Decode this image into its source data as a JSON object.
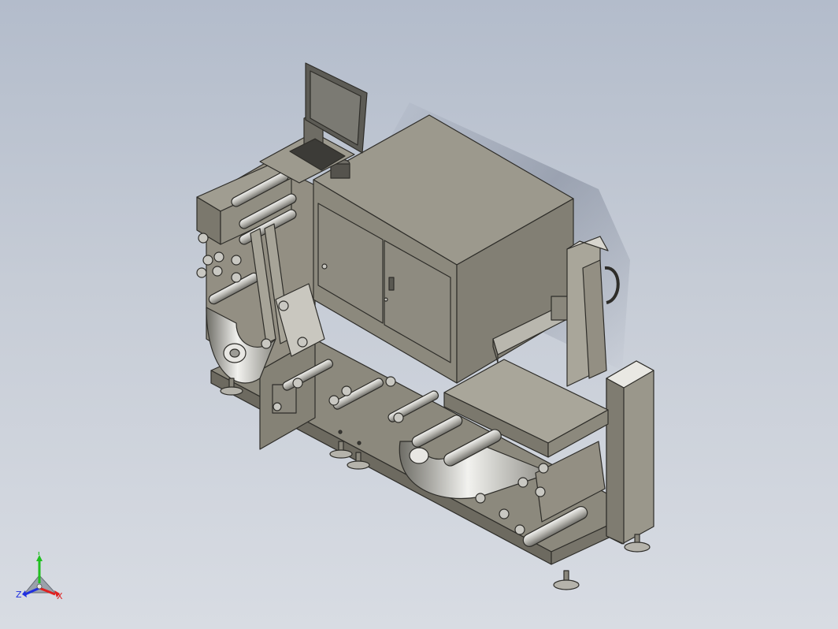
{
  "viewport": {
    "background_top": "#b3bccb",
    "background_bottom": "#d8dce3",
    "model_color": "#8f8c80",
    "model_edge_color": "#2e2d29"
  },
  "triad": {
    "x_label": "X",
    "y_label": "Y",
    "z_label": "Z",
    "x_color": "#e02020",
    "y_color": "#20c020",
    "z_color": "#2030e0"
  }
}
